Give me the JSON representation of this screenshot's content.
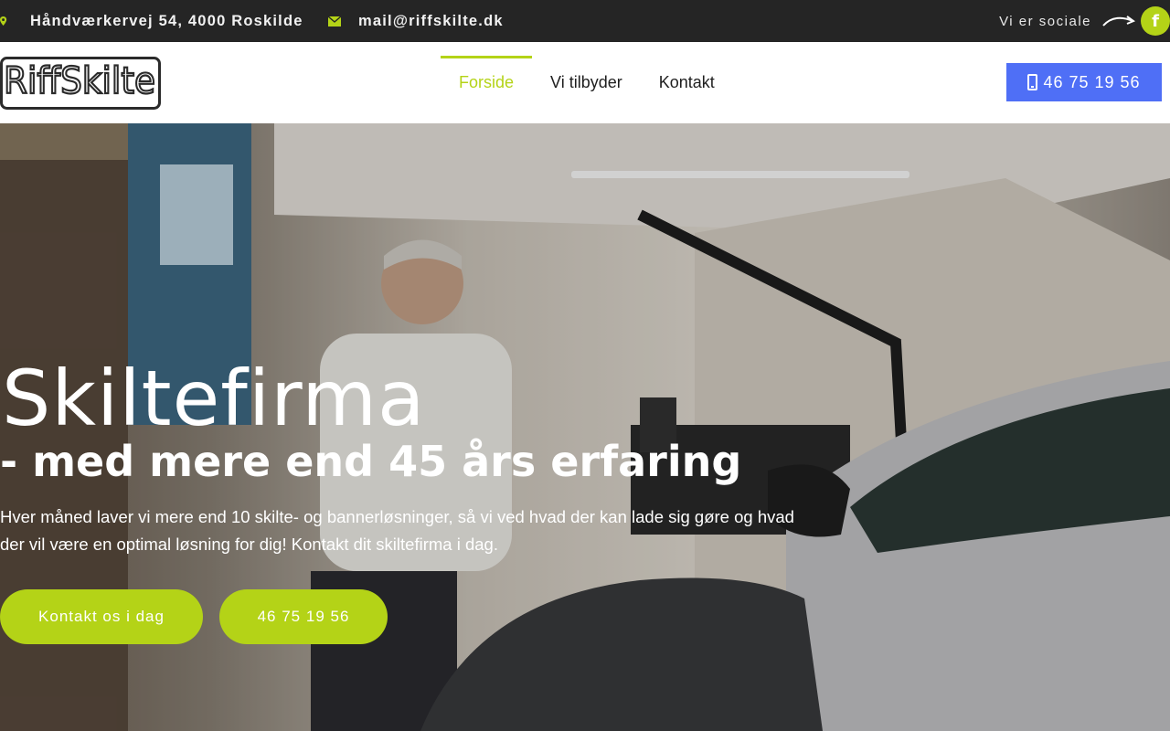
{
  "topbar": {
    "address": "Håndværkervej 54, 4000 Roskilde",
    "email": "mail@riffskilte.dk",
    "social_label": "Vi er sociale",
    "address_icon": "map-marker-icon",
    "email_icon": "envelope-icon",
    "social_icon": "facebook-icon"
  },
  "header": {
    "logo_text": "RiffSkilte",
    "nav": [
      {
        "label": "Forside",
        "active": true
      },
      {
        "label": "Vi tilbyder",
        "active": false
      },
      {
        "label": "Kontakt",
        "active": false
      }
    ],
    "phone_label": "46 75 19 56",
    "phone_icon": "mobile-phone-icon"
  },
  "hero": {
    "title": "Skiltefirma",
    "subtitle": "- med mere end 45 års erfaring",
    "text": "Hver måned laver vi mere end 10 skilte- og bannerløsninger, så vi ved hvad der kan lade sig gøre og hvad der vil være en optimal løsning for dig! Kontakt dit skiltefirma i dag.",
    "cta_primary": "Kontakt os i dag",
    "cta_secondary": "46 75 19 56"
  },
  "colors": {
    "accent": "#b4d317",
    "phone_button": "#4f6ff6",
    "topbar_bg": "#252525"
  }
}
